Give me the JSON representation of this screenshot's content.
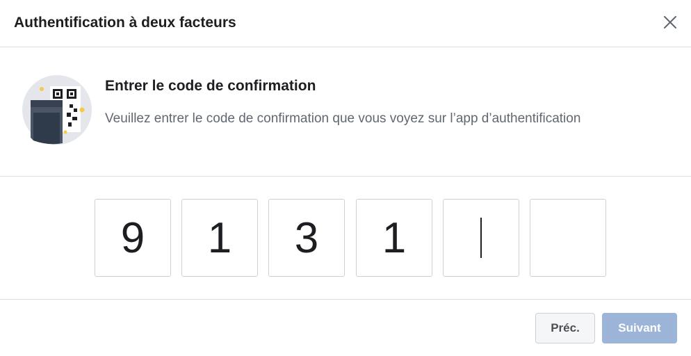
{
  "dialog": {
    "title": "Authentification à deux facteurs",
    "close_icon": "close-icon"
  },
  "intro": {
    "illustration_icon": "qr-code-phone-icon",
    "heading": "Entrer le code de confirmation",
    "description": "Veuillez entrer le code de confirmation que vous voyez sur l’app d’authentification"
  },
  "code": {
    "digits": [
      "9",
      "1",
      "3",
      "1",
      "",
      ""
    ],
    "focused_index": 4
  },
  "footer": {
    "prev_label": "Préc.",
    "next_label": "Suivant",
    "next_disabled": true
  },
  "colors": {
    "primary_disabled": "#9cb4d8",
    "border": "#ccd0d5",
    "divider": "#dddfe2",
    "text": "#1c1e21",
    "secondary_text": "#606770"
  }
}
